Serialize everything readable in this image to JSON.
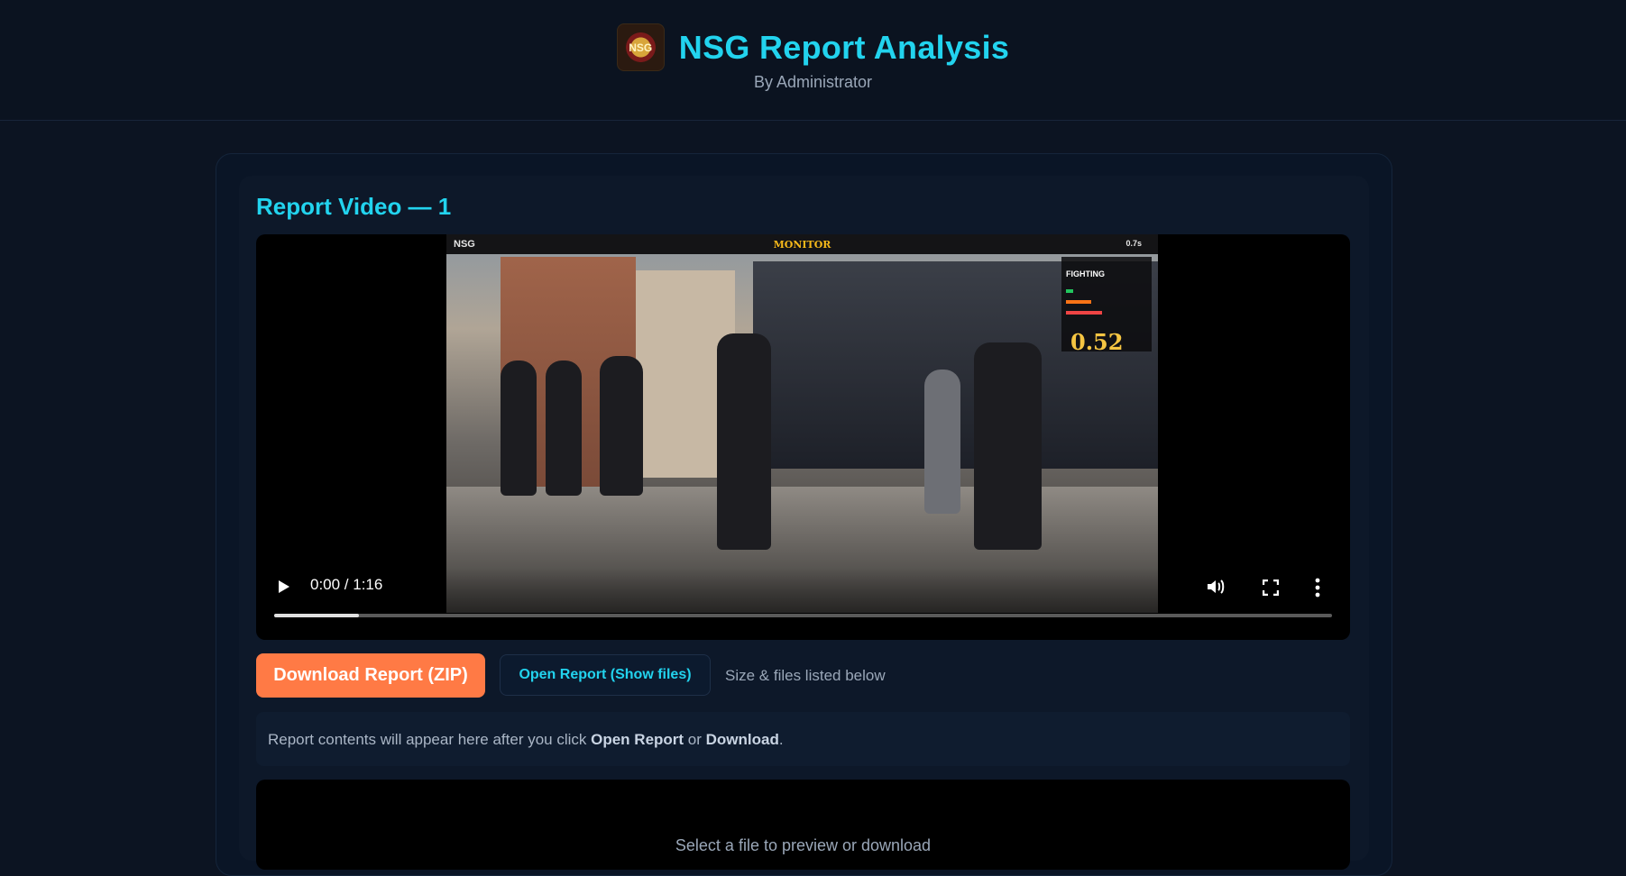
{
  "header": {
    "emblem_text": "NSG",
    "title": "NSG Report Analysis",
    "subtitle": "By Administrator"
  },
  "section": {
    "title": "Report Video — 1"
  },
  "video": {
    "time_display": "0:00 / 1:16",
    "progress_fraction": 0.08,
    "frame_overlay": {
      "left_label": "NSG",
      "center_label": "MONITOR",
      "right_label": "0.7s",
      "activity_label": "FIGHTING",
      "score": "0.52"
    },
    "icons": [
      "play-icon",
      "volume-icon",
      "fullscreen-icon",
      "more-options-icon"
    ]
  },
  "actions": {
    "download_label": "Download Report (ZIP)",
    "open_label": "Open Report (Show files)",
    "hint": "Size & files listed below"
  },
  "notice": {
    "prefix": "Report contents will appear here after you click ",
    "open_word": "Open Report",
    "middle": " or ",
    "download_word": "Download",
    "suffix": "."
  },
  "preview": {
    "placeholder": "Select a file to preview or download"
  },
  "colors": {
    "accent": "#22d3ee",
    "download_button": "#ff7a45",
    "background": "#0c1422"
  }
}
